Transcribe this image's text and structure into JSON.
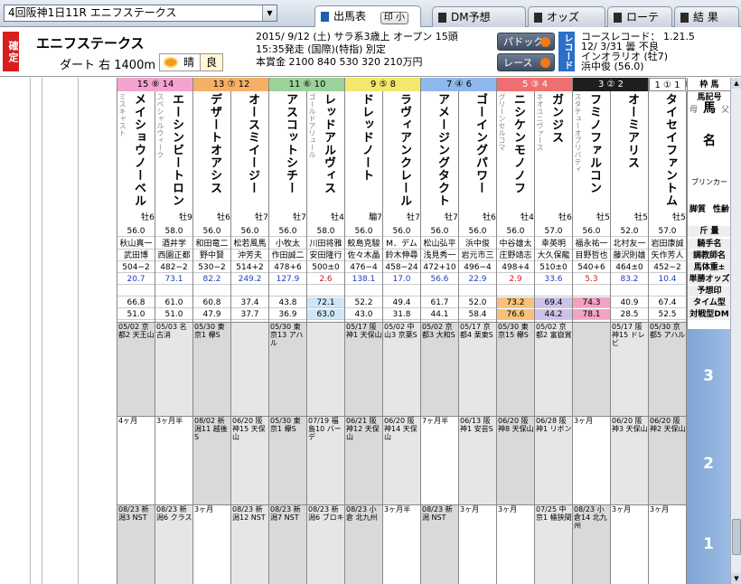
{
  "window": {
    "race_selector": "4回阪神1日11R エニフステークス",
    "tabs": [
      {
        "label": "出馬表",
        "active": true,
        "extra": "印 小"
      },
      {
        "label": "DM予想",
        "active": false
      },
      {
        "label": "オッズ",
        "active": false
      },
      {
        "label": "ローテ",
        "active": false
      },
      {
        "label": "結 果",
        "active": false
      }
    ]
  },
  "race": {
    "status": "確定",
    "name": "エニフステークス",
    "course": "ダート 右 1400m",
    "weather": "晴",
    "ground": "良",
    "meta_line1": "2015/ 9/12 (土) サラ系3歳上 オープン 15頭",
    "meta_line2": "15:35発走 (国際)(特指) 別定",
    "meta_line3": "本賞金 2100 840 530 320 210万円",
    "paddock_label": "パドック",
    "race_label": "レース",
    "record_tag": "レコード",
    "record_line1": "コースレコード： 1.21.5",
    "record_line2": "12/ 3/31 曇 不良",
    "record_line3": "インオラリオ (牡7)",
    "record_line4": "浜中俊 (56.0)"
  },
  "right_labels": {
    "waku": "枠 馬",
    "uma_kigo": "馬記号",
    "mother": "母",
    "horse": "馬",
    "father": "父",
    "name": "名",
    "blinker": "ブリンカー",
    "maoshitsu": "脚質",
    "seirei": "性齢",
    "kinryo": "斤 量",
    "jockey": "騎手名",
    "trainer": "調教師名",
    "weight": "馬体重±",
    "odds": "単勝オッズ",
    "yoso": "予想印",
    "time_dm": "タイム型DM",
    "taisen_dm": "対戦型DM"
  },
  "past_labels": [
    "3",
    "2",
    "1"
  ],
  "horses": [
    {
      "waku": "15 ⑧ 14",
      "name": "メイショウノーベル",
      "sire": "ミスキャスト",
      "sex": "牡6",
      "kinryo": "56.0",
      "jockey": "秋山真一",
      "trainer": "武田博",
      "weight": "504−2",
      "odds": "20.7",
      "dm1": "66.8",
      "dm2": "51.0"
    },
    {
      "waku": "",
      "name": "エーシンビートロン",
      "sire": "スペシャルウィーク",
      "sex": "牡9",
      "kinryo": "58.0",
      "jockey": "酒井学",
      "trainer": "西園正都",
      "weight": "482−2",
      "odds": "73.1",
      "dm1": "61.0",
      "dm2": "51.0"
    },
    {
      "waku": "13 ⑦ 12",
      "name": "デザートオアシス",
      "sire": "",
      "sex": "牡6",
      "kinryo": "56.0",
      "jockey": "和田竜二",
      "trainer": "野中賢",
      "weight": "530−2",
      "odds": "82.2",
      "dm1": "60.8",
      "dm2": "47.9"
    },
    {
      "waku": "",
      "name": "オースミイージー",
      "sire": "",
      "sex": "牡7",
      "kinryo": "56.0",
      "jockey": "松若風馬",
      "trainer": "沖芳夫",
      "weight": "514+2",
      "odds": "249.2",
      "dm1": "37.4",
      "dm2": "37.7"
    },
    {
      "waku": "11 ⑥ 10",
      "name": "アスコットシチー",
      "sire": "",
      "sex": "牡7",
      "kinryo": "56.0",
      "jockey": "小牧太",
      "trainer": "作田誠二",
      "weight": "478+6",
      "odds": "127.9",
      "dm1": "43.8",
      "dm2": "36.9"
    },
    {
      "waku": "",
      "name": "レッドアルヴィス",
      "sire": "ゴールドアリュール",
      "sex": "牡4",
      "kinryo": "58.0",
      "jockey": "川田将雅",
      "trainer": "安田隆行",
      "weight": "500±0",
      "odds": "2.6",
      "dm1": "72.1",
      "dm2": "63.0"
    },
    {
      "waku": "9 ⑤ 8",
      "name": "ドレッドノート",
      "sire": "",
      "sex": "騸7",
      "kinryo": "56.0",
      "jockey": "鮫島克駿",
      "trainer": "佐々木晶",
      "weight": "476−4",
      "odds": "138.1",
      "dm1": "52.2",
      "dm2": "43.0"
    },
    {
      "waku": "",
      "name": "ラヴィアンクレール",
      "sire": "",
      "sex": "牡7",
      "kinryo": "56.0",
      "jockey": "M．デム",
      "trainer": "鈴木伸尋",
      "weight": "458−24",
      "odds": "17.0",
      "dm1": "49.4",
      "dm2": "31.8"
    },
    {
      "waku": "7 ④ 6",
      "name": "アメージングタクト",
      "sire": "",
      "sex": "牡7",
      "kinryo": "56.0",
      "jockey": "松山弘平",
      "trainer": "浅見秀一",
      "weight": "472+10",
      "odds": "56.6",
      "dm1": "61.7",
      "dm2": "44.1"
    },
    {
      "waku": "",
      "name": "ゴーイングパワー",
      "sire": "",
      "sex": "牡6",
      "kinryo": "56.0",
      "jockey": "浜中俊",
      "trainer": "岩元市三",
      "weight": "496−4",
      "odds": "22.9",
      "dm1": "52.0",
      "dm2": "58.4"
    },
    {
      "waku": "5 ③ 4",
      "name": "ニシケンモノノフ",
      "sire": "グリーンセルコマ",
      "sex": "牡4",
      "kinryo": "56.0",
      "jockey": "中谷雄太",
      "trainer": "庄野靖志",
      "weight": "498+4",
      "odds": "2.9",
      "dm1": "73.2",
      "dm2": "76.6"
    },
    {
      "waku": "",
      "name": "ガンジス",
      "sire": "ネオユニヴァース",
      "sex": "牡6",
      "kinryo": "57.0",
      "jockey": "幸英明",
      "trainer": "大久保龍",
      "weight": "510±0",
      "odds": "33.6",
      "dm1": "69.4",
      "dm2": "44.2"
    },
    {
      "waku": "3 ② 2",
      "name": "フミノファルコン",
      "sire": "スタチューオブリバティ",
      "sex": "牡5",
      "kinryo": "56.0",
      "jockey": "福永祐一",
      "trainer": "目野哲也",
      "weight": "540+6",
      "odds": "5.3",
      "dm1": "74.3",
      "dm2": "78.1"
    },
    {
      "waku": "",
      "name": "オーミアリス",
      "sire": "",
      "sex": "牡5",
      "kinryo": "52.0",
      "jockey": "北村友一",
      "trainer": "藤沢則雄",
      "weight": "464±0",
      "odds": "83.2",
      "dm1": "40.9",
      "dm2": "28.5"
    },
    {
      "waku": "1 ① 1",
      "name": "タイセイファントム",
      "sire": "",
      "sex": "牡5",
      "kinryo": "57.0",
      "jockey": "岩田康誠",
      "trainer": "矢作芳人",
      "weight": "452−2",
      "odds": "10.4",
      "dm1": "67.4",
      "dm2": "52.5"
    }
  ],
  "past_runs": {
    "row3": [
      "05/02 京都2 天王山",
      "05/03 名古消",
      "05/30 東京1 欅S",
      "",
      "05/30 東京13 アハル",
      "",
      "05/17 阪神1 天保山",
      "05/02 中山3 京葉S",
      "05/02 京都3 大和S",
      "05/17 京都4 栗東S",
      "05/30 東京15 欅S",
      "05/02 京都2 富嶽賞",
      "",
      "05/17 阪神15 ドレビ",
      "05/30 京都5 アハル"
    ],
    "row2": [
      "4ヶ月",
      "3ヶ月半",
      "08/02 新潟11 越後S",
      "06/20 阪神15 天保山",
      "05/30 東京1 欅S",
      "07/19 福島10 バーデ",
      "06/21 阪神12 天保山",
      "06/20 阪神14 天保山",
      "7ヶ月半",
      "06/13 阪神1 安芸S",
      "06/20 阪神8 天保山",
      "06/28 阪神1 リボン",
      "3ヶ月",
      "06/20 阪神3 天保山",
      "06/20 阪神2 天保山"
    ],
    "row1": [
      "08/23 新潟3 NST",
      "08/23 新潟6 クラス",
      "3ヶ月",
      "08/23 新潟12 NST",
      "08/23 新潟7 NST",
      "08/23 新潟6 ブロキ",
      "08/23 小倉 北九州",
      "3ヶ月半",
      "08/23 新潟 NST",
      "3ヶ月",
      "3ヶ月",
      "07/25 中京1 桶狭間",
      "08/23 小倉14 北九州",
      "3ヶ月",
      "3ヶ月"
    ]
  }
}
